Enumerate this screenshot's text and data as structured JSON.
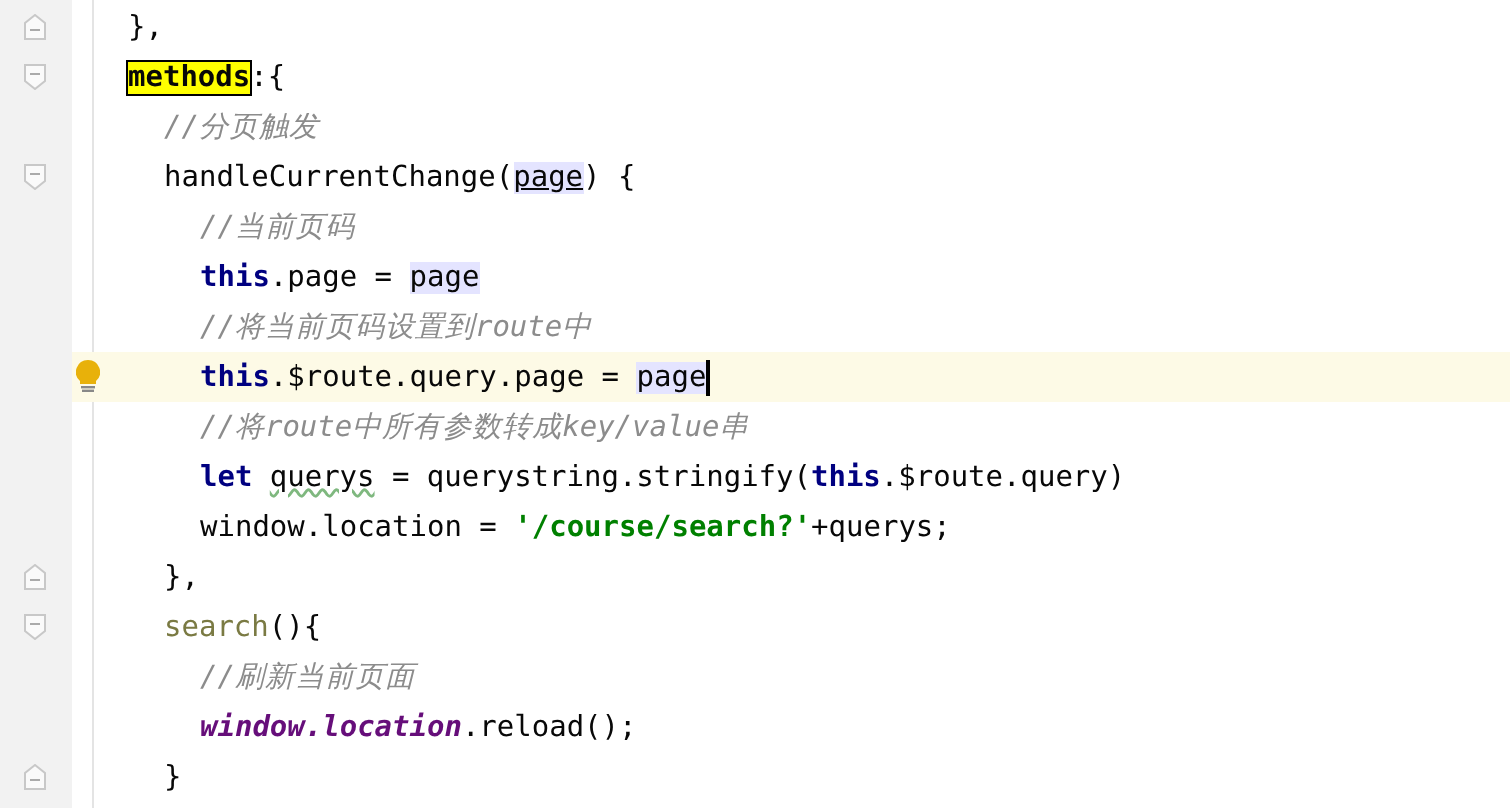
{
  "editor": {
    "lines": [
      {
        "fold_end": true,
        "tokens": [
          {
            "text": "},",
            "kind": "plain"
          }
        ]
      },
      {
        "fold_start": true,
        "tokens": [
          {
            "text": "methods",
            "kind": "search-match"
          },
          {
            "text": ":{",
            "kind": "plain"
          }
        ],
        "children": [
          {
            "tokens": [
              {
                "text": "//分页触发",
                "kind": "comment"
              }
            ]
          },
          {
            "fold_start": true,
            "tokens": [
              {
                "text": "handleCurrentChange(",
                "kind": "plain"
              },
              {
                "text": "page",
                "kind": "param"
              },
              {
                "text": ") {",
                "kind": "plain"
              }
            ],
            "children": [
              {
                "tokens": [
                  {
                    "text": "//当前页码",
                    "kind": "comment"
                  }
                ]
              },
              {
                "tokens": [
                  {
                    "text": "this",
                    "kind": "keyword"
                  },
                  {
                    "text": ".page = ",
                    "kind": "plain"
                  },
                  {
                    "text": "page",
                    "kind": "usage"
                  }
                ]
              },
              {
                "tokens": [
                  {
                    "text": "//将当前页码设置到route中",
                    "kind": "comment"
                  }
                ]
              },
              {
                "current": true,
                "bulb": true,
                "caret": true,
                "tokens": [
                  {
                    "text": "this",
                    "kind": "keyword"
                  },
                  {
                    "text": ".$route.query.page = ",
                    "kind": "plain"
                  },
                  {
                    "text": "page",
                    "kind": "usage"
                  }
                ]
              },
              {
                "tokens": [
                  {
                    "text": "//将route中所有参数转成key/value串",
                    "kind": "comment"
                  }
                ]
              },
              {
                "tokens": [
                  {
                    "text": "let",
                    "kind": "keyword"
                  },
                  {
                    "text": "querys",
                    "kind": "typo"
                  },
                  {
                    "text": "= querystring.stringify(",
                    "kind": "plain"
                  },
                  {
                    "text": "this",
                    "kind": "keyword"
                  },
                  {
                    "text": ".$route.query)",
                    "kind": "plain"
                  }
                ]
              },
              {
                "tokens": [
                  {
                    "text": "window.location = ",
                    "kind": "plain"
                  },
                  {
                    "text": "'/course/search?'",
                    "kind": "string"
                  },
                  {
                    "text": "+querys;",
                    "kind": "plain"
                  }
                ]
              }
            ]
          },
          {
            "fold_end": true,
            "tokens": [
              {
                "text": "},",
                "kind": "plain"
              }
            ]
          },
          {
            "fold_start": true,
            "tokens": [
              {
                "text": "search",
                "kind": "method"
              },
              {
                "text": "(){",
                "kind": "plain"
              }
            ],
            "children": [
              {
                "tokens": [
                  {
                    "text": "//刷新当前页面",
                    "kind": "comment"
                  }
                ]
              },
              {
                "tokens": [
                  {
                    "text": "window.location",
                    "kind": "global"
                  },
                  {
                    "text": ".reload();",
                    "kind": "plain"
                  }
                ]
              }
            ]
          },
          {
            "fold_end": true,
            "tokens": [
              {
                "text": "}",
                "kind": "plain"
              }
            ]
          }
        ]
      }
    ]
  }
}
